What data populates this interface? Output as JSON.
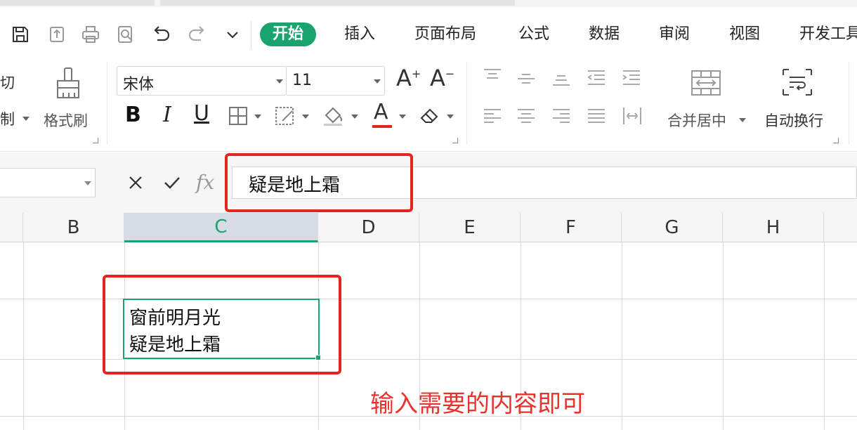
{
  "quick_access": {
    "icons": [
      "save-icon",
      "export-icon",
      "print-icon",
      "print-preview-icon",
      "undo-icon",
      "redo-icon",
      "more-dropdown-icon"
    ]
  },
  "menu": {
    "tabs": [
      "开始",
      "插入",
      "页面布局",
      "公式",
      "数据",
      "审阅",
      "视图",
      "开发工具"
    ],
    "active_index": 0
  },
  "ribbon": {
    "cut_label": "切",
    "copy_label": "制",
    "format_painter_label": "格式刷",
    "font_name": "宋体",
    "font_size": "11",
    "bold_label": "B",
    "italic_label": "I",
    "underline_label": "U",
    "font_color_label": "A",
    "merge_center_label": "合并居中",
    "wrap_text_label": "自动换行",
    "increase_font_label": "A",
    "decrease_font_label": "A"
  },
  "formula_bar": {
    "fx_label": "fx",
    "content": "疑是地上霜"
  },
  "sheet": {
    "columns": [
      "B",
      "C",
      "D",
      "E",
      "F",
      "G",
      "H"
    ],
    "selected_column": "C",
    "active_cell_lines": [
      "窗前明月光",
      "疑是地上霜"
    ]
  },
  "annotation": "输入需要的内容即可",
  "colors": {
    "accent": "#1aa36f",
    "highlight_red": "#e52420",
    "annotation_red": "#e8322e"
  }
}
